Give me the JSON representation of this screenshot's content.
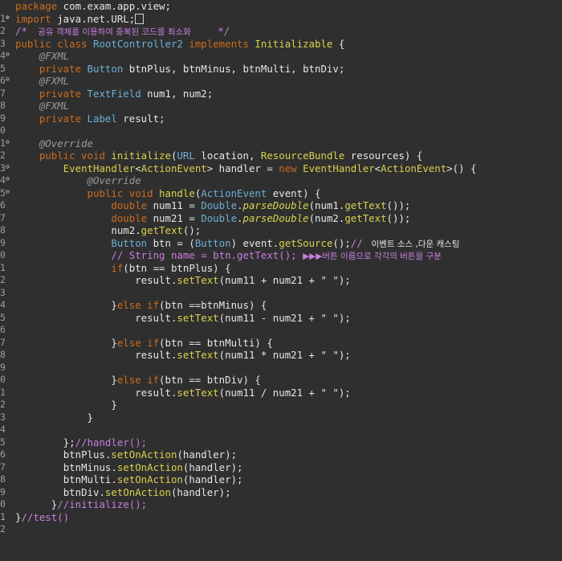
{
  "editor": {
    "gutter_numbers": [
      "1",
      "2",
      "3",
      "4",
      "5",
      "6",
      "7",
      "8",
      "9",
      "0",
      "1",
      "2",
      "3",
      "4",
      "5",
      "6",
      "7",
      "8",
      "9",
      "0",
      "1",
      "2",
      "3",
      "4",
      "5",
      "6",
      "7",
      "8",
      "9",
      "0",
      "1",
      "2",
      "3",
      "4",
      "5",
      "6",
      "7",
      "8",
      "9",
      "0",
      "1",
      "2"
    ],
    "markers": {
      "2": "⊕",
      "4": "⊖",
      "6": "⊖",
      "10": "⊖",
      "12": "⊖",
      "13": "⊖",
      "14": "⊖"
    },
    "code": {
      "l1_kw": "package",
      "l1_txt": " com.exam.app.view;",
      "l2_kw": "import",
      "l2_txt": " java.net.URL;",
      "l3_cm1": "/*",
      "l3_cmk": "    공유 객체를 이용하여 중복된 코드를 최소화          ",
      "l3_cm2": "*/",
      "l4_kw": "public class",
      "l4_cls": " RootController2",
      "l4_kw2": " implements",
      "l4_cls2": " Initializable",
      "l4_txt": " {",
      "l5_ann": "@FXML",
      "l6_kw": "private",
      "l6_ty": " Button",
      "l6_txt": " btnPlus, btnMinus, btnMulti, btnDiv;",
      "l7_ann": "@FXML",
      "l8_kw": "private",
      "l8_ty": " TextField",
      "l8_txt": " num1, num2;",
      "l9_ann": "@FXML",
      "l10_kw": "private",
      "l10_ty": " Label",
      "l10_txt": " result;",
      "l12_ann": "@Override",
      "l13_kw": "public void",
      "l13_fn": " initialize",
      "l13_t1": "(",
      "l13_ty": "URL",
      "l13_t2": " location, ",
      "l13_ty2": "ResourceBundle",
      "l13_t3": " resources) {",
      "l14_ty": "EventHandler",
      "l14_t1": "<",
      "l14_ty2": "ActionEvent",
      "l14_t2": "> handler = ",
      "l14_kw": "new",
      "l14_ty3": " EventHandler",
      "l14_t3": "<",
      "l14_ty4": "ActionEvent",
      "l14_t4": ">() {",
      "l15_ann": "@Override",
      "l16_kw": "public void",
      "l16_fn": " handle",
      "l16_t1": "(",
      "l16_ty": "ActionEvent",
      "l16_t2": " event) {",
      "l17_kw": "double",
      "l17_t1": " num11 = ",
      "l17_ty": "Double",
      "l17_t2": ".",
      "l17_fn": "parseDouble",
      "l17_t3": "(num1.",
      "l17_fn2": "getText",
      "l17_t4": "());",
      "l18_kw": "double",
      "l18_t1": " num21 = ",
      "l18_ty": "Double",
      "l18_t2": ".",
      "l18_fn": "parseDouble",
      "l18_t3": "(num2.",
      "l18_fn2": "getText",
      "l18_t4": "());",
      "l19_t1": "num2.",
      "l19_fn": "getText",
      "l19_t2": "();",
      "l20_ty": "Button",
      "l20_t1": " btn = (",
      "l20_ty2": "Button",
      "l20_t2": ") event.",
      "l20_fn": "getSource",
      "l20_t3": "();",
      "l20_cm": "// ",
      "l20_cmk": " 이벤트 소스 ,다운 캐스팅",
      "l21_cm": "// String name = btn.getText(); ",
      "l21_cmk": "▶▶▶버튼 이름으로 각각의 버튼을 구분",
      "l22_kw": "if",
      "l22_t": "(btn == btnPlus) {",
      "l23_t1": "result.",
      "l23_fn": "setText",
      "l23_t2": "(num11 + num21 + \" \");",
      "l25_t0": "}",
      "l25_kw": "else if",
      "l25_t": "(btn ==btnMinus) {",
      "l26_t1": "result.",
      "l26_fn": "setText",
      "l26_t2": "(num11 - num21 + \" \");",
      "l28_t0": "}",
      "l28_kw": "else if",
      "l28_t": "(btn == btnMulti) {",
      "l29_t1": "result.",
      "l29_fn": "setText",
      "l29_t2": "(num11 * num21 + \" \");",
      "l31_t0": "}",
      "l31_kw": "else if",
      "l31_t": "(btn == btnDiv) {",
      "l32_t1": "result.",
      "l32_fn": "setText",
      "l32_t2": "(num11 / num21 + \" \");",
      "l33_t": "}",
      "l34_t": "}",
      "l36_t": "};",
      "l36_cm": "//handler();",
      "l37_t1": "btnPlus.",
      "l37_fn": "setOnAction",
      "l37_t2": "(handler);",
      "l38_t1": "btnMinus.",
      "l38_fn": "setOnAction",
      "l38_t2": "(handler);",
      "l39_t1": "btnMulti.",
      "l39_fn": "setOnAction",
      "l39_t2": "(handler);",
      "l40_t1": "btnDiv.",
      "l40_fn": "setOnAction",
      "l40_t2": "(handler);",
      "l41_t": "}",
      "l41_cm": "//initialize();",
      "l42_t": "}",
      "l42_cm": "//test()"
    }
  },
  "colors": {
    "background": "#2f2f2f",
    "keyword": "#cc6c1d",
    "type": "#6cb0d6",
    "method": "#d9d24e",
    "comment": "#c97ee0",
    "annotation": "#9a9a9a"
  }
}
